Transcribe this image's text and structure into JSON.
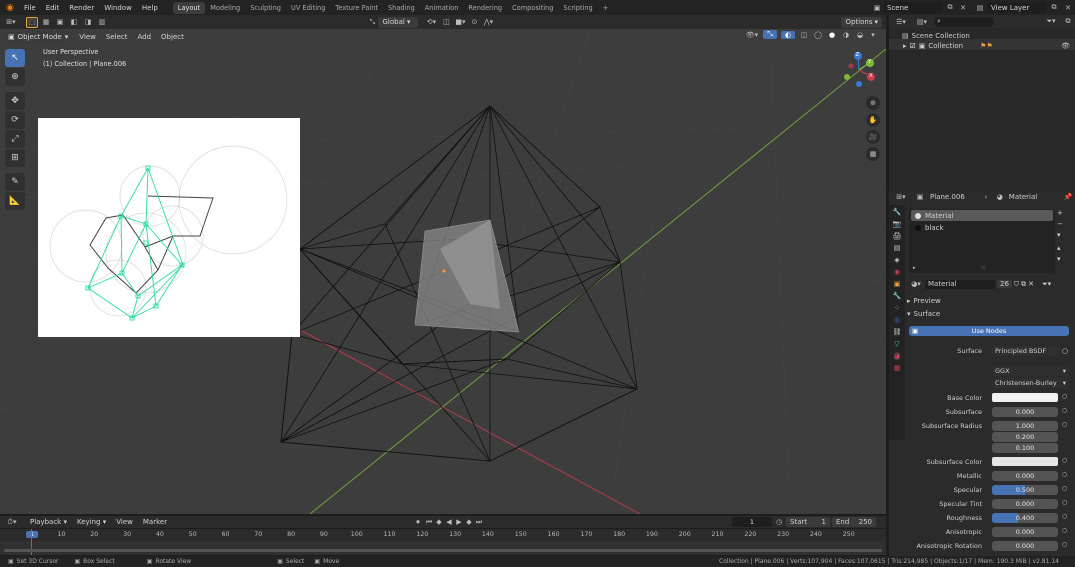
{
  "topbar": {
    "menus": [
      "File",
      "Edit",
      "Render",
      "Window",
      "Help"
    ],
    "workspaces": [
      "Layout",
      "Modeling",
      "Sculpting",
      "UV Editing",
      "Texture Paint",
      "Shading",
      "Animation",
      "Rendering",
      "Compositing",
      "Scripting"
    ],
    "active_workspace": "Layout",
    "add_tab": "+",
    "scene_label": "Scene",
    "view_layer_label": "View Layer"
  },
  "viewport_header": {
    "mode": "Object Mode",
    "menus": [
      "View",
      "Select",
      "Add",
      "Object"
    ],
    "transform_orientation": "Global",
    "options_label": "Options"
  },
  "viewport": {
    "perspective_label": "User Perspective",
    "collection_label": "(1) Collection | Plane.006",
    "gizmo_axes": [
      "Z",
      "Y",
      "X"
    ]
  },
  "outliner": {
    "search_placeholder": "",
    "scene_collection": "Scene Collection",
    "collection": "Collection"
  },
  "properties": {
    "object_name": "Plane.006",
    "material_tab": "Material",
    "slots": [
      "Material",
      "black"
    ],
    "material_name": "Material",
    "user_count": "26",
    "preview_label": "Preview",
    "surface_label": "Surface",
    "use_nodes_label": "Use Nodes",
    "surface_row_label": "Surface",
    "surface_value": "Principled BSDF",
    "distribution": "GGX",
    "subsurface_method": "Christensen-Burley",
    "rows": [
      {
        "label": "Base Color",
        "value": "",
        "kind": "color",
        "color": "#f2f2f2"
      },
      {
        "label": "Subsurface",
        "value": "0.000",
        "kind": "num"
      },
      {
        "label": "Subsurface Radius",
        "value": "1.000",
        "kind": "num"
      },
      {
        "label": "",
        "value": "0.200",
        "kind": "num"
      },
      {
        "label": "",
        "value": "0.100",
        "kind": "num"
      },
      {
        "label": "Subsurface Color",
        "value": "",
        "kind": "color",
        "color": "#e6e6e6"
      },
      {
        "label": "Metallic",
        "value": "0.000",
        "kind": "num"
      },
      {
        "label": "Specular",
        "value": "0.500",
        "kind": "slider",
        "fill": 0.5
      },
      {
        "label": "Specular Tint",
        "value": "0.000",
        "kind": "num"
      },
      {
        "label": "Roughness",
        "value": "0.400",
        "kind": "slider",
        "fill": 0.4
      },
      {
        "label": "Anisotropic",
        "value": "0.000",
        "kind": "num"
      },
      {
        "label": "Anisotropic Rotation",
        "value": "0.000",
        "kind": "num"
      }
    ]
  },
  "timeline": {
    "menus": [
      "Playback",
      "Keying",
      "View",
      "Marker"
    ],
    "current_frame": "1",
    "start_label": "Start",
    "start_value": "1",
    "end_label": "End",
    "end_value": "250",
    "ticks": [
      "1",
      "10",
      "20",
      "30",
      "40",
      "50",
      "60",
      "70",
      "80",
      "90",
      "100",
      "110",
      "120",
      "130",
      "140",
      "150",
      "160",
      "170",
      "180",
      "190",
      "200",
      "210",
      "220",
      "230",
      "240",
      "250"
    ]
  },
  "statusbar": {
    "left_hints": [
      "Set 3D Cursor",
      "Box Select",
      "Rotate View",
      "Select",
      "Move"
    ],
    "stats": "Collection | Plane.006 | Verts:107,904 | Faces:107,0615 | Tris:214,985 | Objects:1/17 | Mem: 190.3 MiB | v2.81.14"
  },
  "colors": {
    "accent": "#4772b3",
    "axis_x": "#c93b4f",
    "axis_y": "#7fb93b",
    "axis_z": "#3a7ad6",
    "overlay_green": "#2bd9a4"
  }
}
